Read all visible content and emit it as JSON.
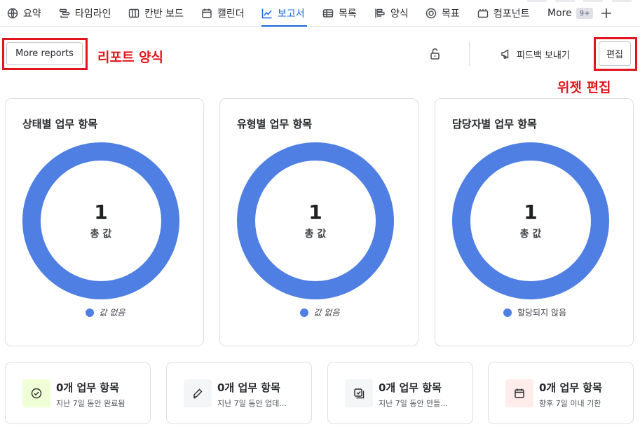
{
  "nav": {
    "items": [
      {
        "label": "요약",
        "icon": "globe-icon"
      },
      {
        "label": "타임라인",
        "icon": "timeline-icon"
      },
      {
        "label": "칸반 보드",
        "icon": "board-icon"
      },
      {
        "label": "캘린더",
        "icon": "calendar-icon"
      },
      {
        "label": "보고서",
        "icon": "chart-line-icon",
        "active": true
      },
      {
        "label": "목록",
        "icon": "list-icon"
      },
      {
        "label": "양식",
        "icon": "form-icon"
      },
      {
        "label": "목표",
        "icon": "goal-icon"
      },
      {
        "label": "컴포넌트",
        "icon": "component-icon"
      }
    ],
    "more_label": "More",
    "more_count": "9+",
    "accent": "#1868db"
  },
  "toolbar": {
    "more_reports_label": "More reports",
    "feedback_label": "피드백 보내기",
    "edit_label": "편집"
  },
  "annotations": {
    "report_template": "리포트 양식",
    "widget_edit": "위젯 편집",
    "color": "#e3141b"
  },
  "donut_cards": [
    {
      "title": "상태별 업무 항목",
      "total": "1",
      "total_label": "총 값",
      "legend": "값 없음",
      "legend_italic": true
    },
    {
      "title": "유형별 업무 항목",
      "total": "1",
      "total_label": "총 값",
      "legend": "값 없음",
      "legend_italic": true
    },
    {
      "title": "담당자별 업무 항목",
      "total": "1",
      "total_label": "총 값",
      "legend": "할당되지 않음",
      "legend_italic": false
    }
  ],
  "donut_color": "#4f7fe3",
  "stat_cards": [
    {
      "title": "0개 업무 항목",
      "sub": "지난 7일 동안 완료됨",
      "icon": "check-circle-icon",
      "bg": "#efffd6"
    },
    {
      "title": "0개 업무 항목",
      "sub": "지난 7일 동안 업데...",
      "icon": "pencil-icon",
      "bg": "#f4f5f7"
    },
    {
      "title": "0개 업무 항목",
      "sub": "지난 7일 동안 만들...",
      "icon": "add-task-icon",
      "bg": "#f4f5f7"
    },
    {
      "title": "0개 업무 항목",
      "sub": "향후 7일 이내 기한",
      "icon": "calendar-icon",
      "bg": "#ffeceb"
    }
  ]
}
